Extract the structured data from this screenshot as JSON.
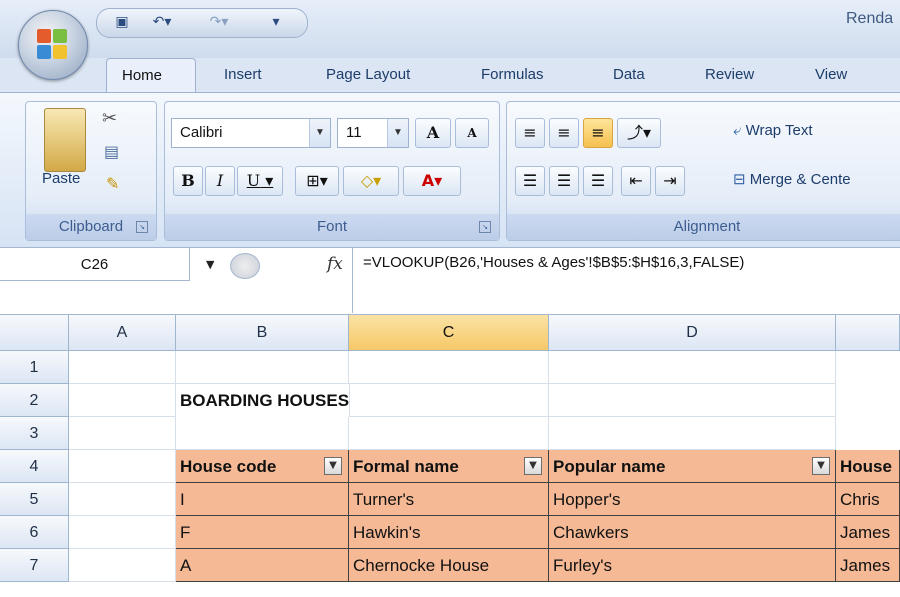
{
  "window": {
    "title": "Renda"
  },
  "quick_access": {
    "save_icon": "save-icon",
    "undo_icon": "undo-icon",
    "redo_icon": "redo-icon",
    "customize_icon": "customize-icon"
  },
  "tabs": [
    "Home",
    "Insert",
    "Page Layout",
    "Formulas",
    "Data",
    "Review",
    "View"
  ],
  "ribbon": {
    "clipboard": {
      "label": "Clipboard",
      "paste": "Paste"
    },
    "font": {
      "label": "Font",
      "name": "Calibri",
      "size": "11",
      "bold": "B",
      "italic": "I",
      "underline": "U",
      "grow": "A",
      "shrink": "A"
    },
    "alignment": {
      "label": "Alignment",
      "wrap_text": "Wrap Text",
      "merge": "Merge & Cente"
    }
  },
  "formula_bar": {
    "name_box": "C26",
    "fx": "fx",
    "formula": "=VLOOKUP(B26,'Houses & Ages'!$B$5:$H$16,3,FALSE)"
  },
  "sheet": {
    "columns": [
      "A",
      "B",
      "C",
      "D",
      ""
    ],
    "rows": [
      "1",
      "2",
      "3",
      "4",
      "5",
      "6",
      "7"
    ],
    "title": "BOARDING HOUSES",
    "headers": [
      "House code",
      "Formal name",
      "Popular name",
      "House"
    ],
    "data": [
      [
        "I",
        "Turner's",
        "Hopper's",
        "Chris"
      ],
      [
        "F",
        "Hawkin's",
        "Chawkers",
        "James"
      ],
      [
        "A",
        "Chernocke House",
        "Furley's",
        "James"
      ]
    ]
  },
  "colors": {
    "table_fill": "#f5b995",
    "selected_col": "#f6c867"
  }
}
